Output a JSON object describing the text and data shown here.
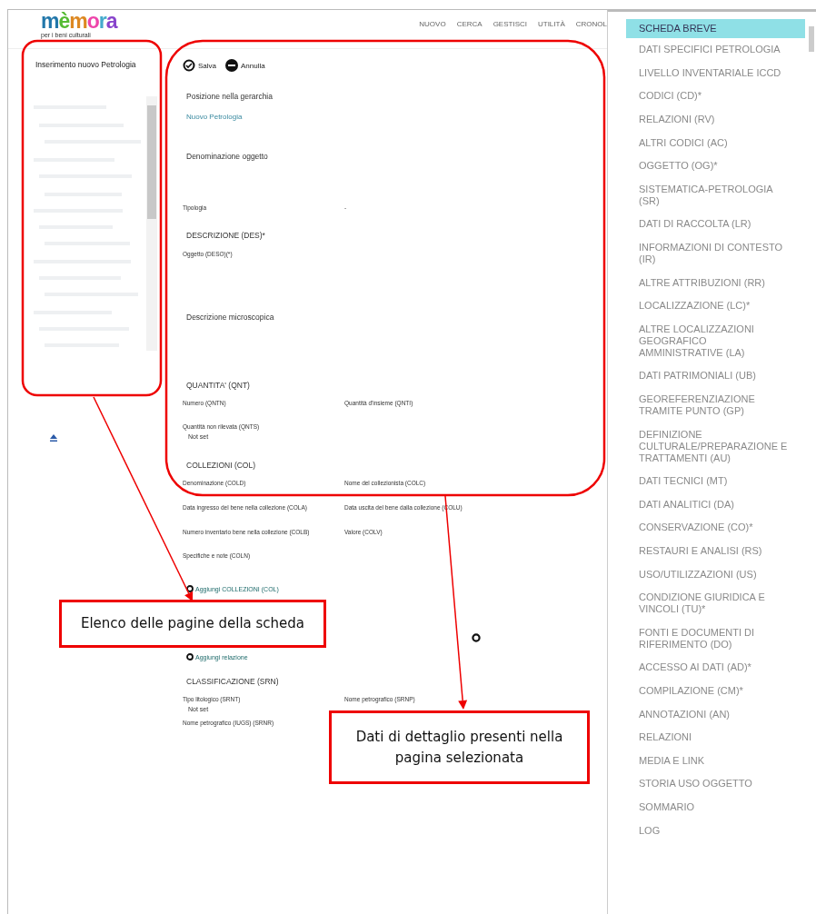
{
  "header": {
    "logo": "mèmora",
    "tagline": "per i beni culturali",
    "nav": [
      {
        "label": "NUOVO"
      },
      {
        "label": "CERCA"
      },
      {
        "label": "GESTISCI"
      },
      {
        "label": "UTILITÀ"
      },
      {
        "label": "CRONOL"
      }
    ]
  },
  "left_panel": {
    "title": "Inserimento nuovo Petrologia"
  },
  "toolbar": [
    {
      "kind": "save",
      "label": "Salva"
    },
    {
      "kind": "cancel",
      "label": "Annulla"
    }
  ],
  "form": [
    {
      "kind": "heading",
      "text": "Posizione nella gerarchia"
    },
    {
      "kind": "link",
      "text": "Nuovo Petrologia"
    },
    {
      "kind": "heading",
      "text": "Denominazione oggetto"
    },
    {
      "kind": "pair",
      "left": "Tipologia",
      "right": "-"
    },
    {
      "kind": "heading",
      "text": "DESCRIZIONE (DES)*"
    },
    {
      "kind": "label",
      "text": "Oggetto (DESO)(*)"
    },
    {
      "kind": "heading",
      "text": "Descrizione microscopica"
    },
    {
      "kind": "heading",
      "text": "QUANTITA' (QNT)"
    },
    {
      "kind": "pair",
      "left": "Numero (QNTN)",
      "right": "Quantità d'insieme (QNTI)"
    },
    {
      "kind": "label",
      "text": "Quantità non rilevata (QNTS)"
    },
    {
      "kind": "value",
      "text": "Not set"
    },
    {
      "kind": "heading",
      "text": "COLLEZIONI (COL)"
    },
    {
      "kind": "pair",
      "left": "Denominazione (COLD)",
      "right": "Nome del collezionista (COLC)"
    },
    {
      "kind": "pair",
      "left": "Data ingresso del bene nella collezione (COLA)",
      "right": "Data uscita del bene dalla collezione (COLU)"
    },
    {
      "kind": "pair",
      "left": "Numero inventario bene nella collezione (COLB)",
      "right": "Valore (COLV)"
    },
    {
      "kind": "label",
      "text": "Specifiche e note (COLN)"
    },
    {
      "kind": "add",
      "text": "Aggiungi COLLEZIONI (COL)"
    },
    {
      "kind": "add_icon"
    },
    {
      "kind": "add",
      "text": "Aggiungi relazione"
    },
    {
      "kind": "heading",
      "text": "CLASSIFICAZIONE (SRN)"
    },
    {
      "kind": "pair",
      "left": "Tipo litologico (SRNT)",
      "right": "Nome petrografico (SRNP)"
    },
    {
      "kind": "value",
      "text": "Not set"
    },
    {
      "kind": "label",
      "text": "Nome petrografico (IUGS) (SRNR)"
    }
  ],
  "sidebar": {
    "items": [
      {
        "label": "SCHEDA BREVE",
        "selected": true
      },
      {
        "label": "DATI SPECIFICI PETROLOGIA",
        "selected": false
      },
      {
        "label": "LIVELLO INVENTARIALE ICCD",
        "selected": false
      },
      {
        "label": "CODICI (CD)*",
        "selected": false
      },
      {
        "label": "RELAZIONI (RV)",
        "selected": false
      },
      {
        "label": "ALTRI CODICI (AC)",
        "selected": false
      },
      {
        "label": "OGGETTO (OG)*",
        "selected": false
      },
      {
        "label": "SISTEMATICA-PETROLOGIA (SR)",
        "selected": false
      },
      {
        "label": "DATI DI RACCOLTA (LR)",
        "selected": false
      },
      {
        "label": "INFORMAZIONI DI CONTESTO (IR)",
        "selected": false
      },
      {
        "label": "ALTRE ATTRIBUZIONI (RR)",
        "selected": false
      },
      {
        "label": "LOCALIZZAZIONE (LC)*",
        "selected": false
      },
      {
        "label": "ALTRE LOCALIZZAZIONI GEOGRAFICO AMMINISTRATIVE (LA)",
        "selected": false
      },
      {
        "label": "DATI PATRIMONIALI (UB)",
        "selected": false
      },
      {
        "label": "GEOREFERENZIAZIONE TRAMITE PUNTO (GP)",
        "selected": false
      },
      {
        "label": "DEFINIZIONE CULTURALE/PREPARAZIONE E TRATTAMENTI (AU)",
        "selected": false
      },
      {
        "label": "DATI TECNICI (MT)",
        "selected": false
      },
      {
        "label": "DATI ANALITICI (DA)",
        "selected": false
      },
      {
        "label": "CONSERVAZIONE (CO)*",
        "selected": false
      },
      {
        "label": "RESTAURI E ANALISI (RS)",
        "selected": false
      },
      {
        "label": "USO/UTILIZZAZIONI (US)",
        "selected": false
      },
      {
        "label": "CONDIZIONE GIURIDICA E VINCOLI (TU)*",
        "selected": false
      },
      {
        "label": "FONTI E DOCUMENTI DI RIFERIMENTO (DO)",
        "selected": false
      },
      {
        "label": "ACCESSO AI DATI (AD)*",
        "selected": false
      },
      {
        "label": "COMPILAZIONE (CM)*",
        "selected": false
      },
      {
        "label": "ANNOTAZIONI (AN)",
        "selected": false
      },
      {
        "label": "RELAZIONI",
        "selected": false
      },
      {
        "label": "MEDIA E LINK",
        "selected": false
      },
      {
        "label": "STORIA USO OGGETTO",
        "selected": false
      },
      {
        "label": "SOMMARIO",
        "selected": false
      },
      {
        "label": "LOG",
        "selected": false
      }
    ]
  },
  "callouts": [
    {
      "text": "Elenco delle pagine della scheda"
    },
    {
      "text": "Dati di dettaglio presenti nella pagina selezionata"
    }
  ]
}
